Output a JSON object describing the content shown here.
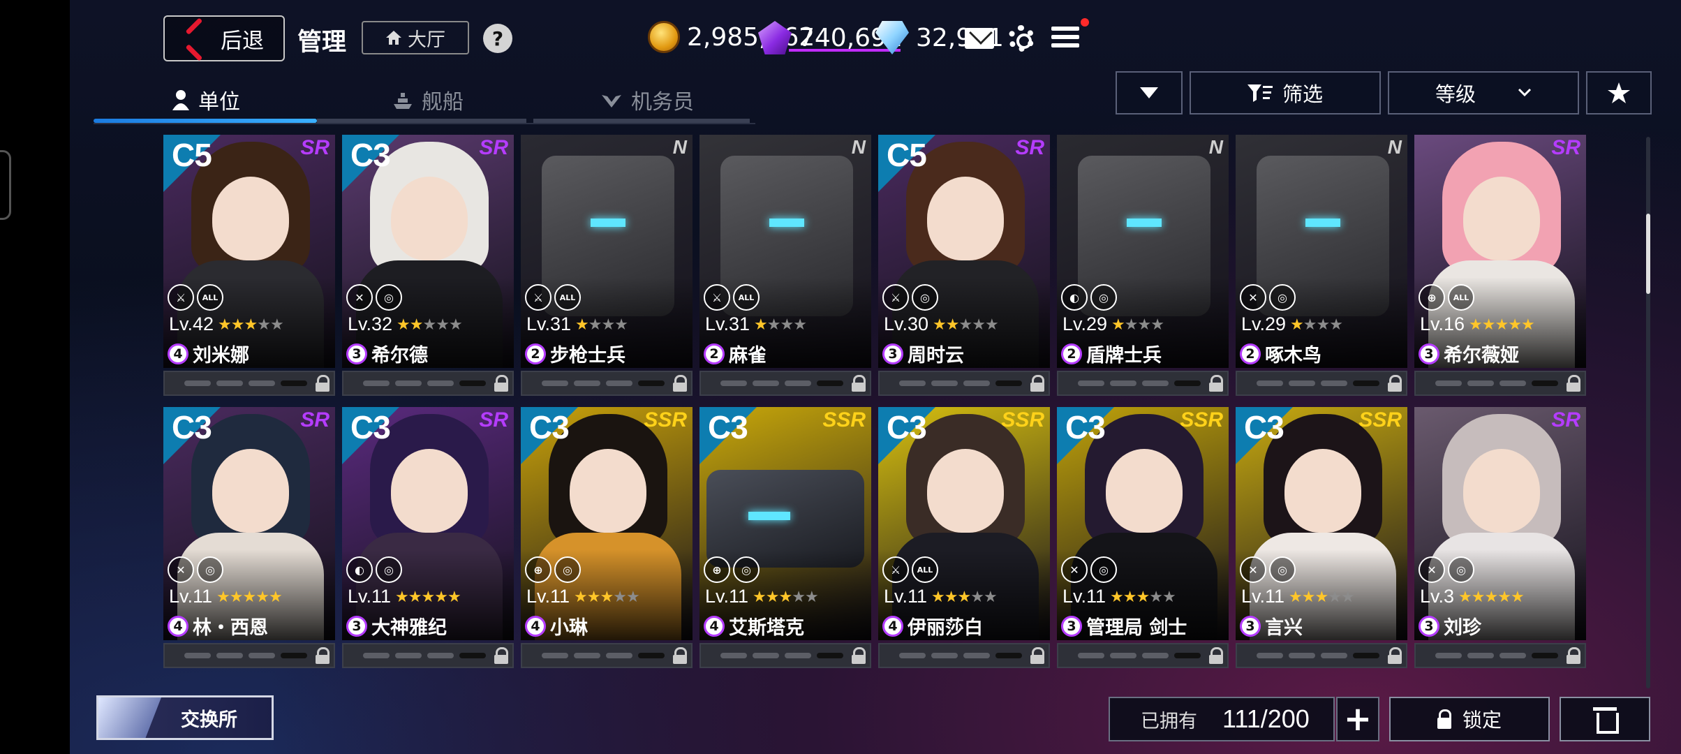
{
  "header": {
    "back_label": "后退",
    "title": "管理",
    "lobby_label": "大厅",
    "help_label": "?"
  },
  "resources": {
    "gold": "2,985,562",
    "gems": "740,692",
    "diamonds": "32,911"
  },
  "tabs": [
    {
      "label": "单位",
      "icon": "person-icon",
      "active": true
    },
    {
      "label": "舰船",
      "icon": "ship-icon",
      "active": false
    },
    {
      "label": "机务员",
      "icon": "wings-icon",
      "active": false
    }
  ],
  "filters": {
    "dropdown_icon": "triangle-down-icon",
    "filter_label": "筛选",
    "sort_label": "等级",
    "favorite_icon": "star-icon"
  },
  "units": [
    {
      "cls": "C5",
      "rarity": "SR",
      "roles": [
        "RF",
        "ALL"
      ],
      "level": "Lv.42",
      "stars": 3,
      "cost": "4",
      "name": "刘米娜",
      "hair": "#3b2416",
      "outfit": "#2b2b30",
      "bg": "#4a2a5e"
    },
    {
      "cls": "C3",
      "rarity": "SR",
      "roles": [
        "SW",
        "SH"
      ],
      "level": "Lv.32",
      "stars": 2,
      "cost": "3",
      "name": "希尔德",
      "hair": "#e8e6e2",
      "outfit": "#1d1d22",
      "bg": "#5a3a6e"
    },
    {
      "cls": "",
      "rarity": "N",
      "roles": [
        "RF",
        "ALL"
      ],
      "level": "Lv.31",
      "stars": 1,
      "max_stars": 4,
      "cost": "2",
      "name": "步枪士兵",
      "mech": true,
      "bg": "#2a2a32"
    },
    {
      "cls": "",
      "rarity": "N",
      "roles": [
        "RF",
        "ALL"
      ],
      "level": "Lv.31",
      "stars": 1,
      "max_stars": 4,
      "cost": "2",
      "name": "麻雀",
      "mech": true,
      "bg": "#333338"
    },
    {
      "cls": "C5",
      "rarity": "SR",
      "roles": [
        "RF",
        "SH"
      ],
      "level": "Lv.30",
      "stars": 2,
      "cost": "3",
      "name": "周时云",
      "hair": "#4a2a1c",
      "outfit": "#222226",
      "bg": "#4a2a5e"
    },
    {
      "cls": "",
      "rarity": "N",
      "roles": [
        "DF",
        "SH"
      ],
      "level": "Lv.29",
      "stars": 1,
      "max_stars": 4,
      "cost": "2",
      "name": "盾牌士兵",
      "mech": true,
      "bg": "#2a2a30"
    },
    {
      "cls": "",
      "rarity": "N",
      "roles": [
        "SW",
        "SH"
      ],
      "level": "Lv.29",
      "stars": 1,
      "max_stars": 4,
      "cost": "2",
      "name": "啄木鸟",
      "mech": true,
      "bg": "#303036"
    },
    {
      "cls": "",
      "rarity": "SR",
      "roles": [
        "TG",
        "ALL"
      ],
      "level": "Lv.16",
      "stars": 5,
      "cost": "3",
      "name": "希尔薇娅",
      "hair": "#f2a2b2",
      "outfit": "#eae6e2",
      "bg": "#6a4a7e"
    },
    {
      "cls": "C3",
      "rarity": "SR",
      "roles": [
        "SW",
        "SH"
      ],
      "level": "Lv.11",
      "stars": 5,
      "cost": "4",
      "name": "林・西恩",
      "hair": "#1f2a3e",
      "outfit": "#e4dcd4",
      "bg": "#4a2a5e"
    },
    {
      "cls": "C3",
      "rarity": "SR",
      "roles": [
        "DF",
        "SH"
      ],
      "level": "Lv.11",
      "stars": 5,
      "cost": "3",
      "name": "大神雅纪",
      "hair": "#2a1a4a",
      "outfit": "#3a2a44",
      "bg": "#5a2a7e"
    },
    {
      "cls": "C3",
      "rarity": "SSR",
      "roles": [
        "TG",
        "SH"
      ],
      "level": "Lv.11",
      "stars": 3,
      "cost": "4",
      "name": "小琳",
      "hair": "#1a1410",
      "outfit": "#d6922a",
      "bg": "#c9a20a"
    },
    {
      "cls": "C3",
      "rarity": "SSR",
      "roles": [
        "TG",
        "SH"
      ],
      "level": "Lv.11",
      "stars": 3,
      "cost": "4",
      "name": "艾斯塔克",
      "mech": true,
      "tank": true,
      "bg": "#c9a80a"
    },
    {
      "cls": "C3",
      "rarity": "SSR",
      "roles": [
        "RF",
        "ALL"
      ],
      "level": "Lv.11",
      "stars": 3,
      "cost": "4",
      "name": "伊丽莎白",
      "hair": "#3a2c26",
      "outfit": "#1c1c24",
      "bg": "#d8c010"
    },
    {
      "cls": "C3",
      "rarity": "SSR",
      "roles": [
        "SW",
        "SH"
      ],
      "level": "Lv.11",
      "stars": 3,
      "cost": "3",
      "name": "管理局 剑士",
      "hair": "#241a30",
      "outfit": "#141418",
      "bg": "#c0a20a"
    },
    {
      "cls": "C3",
      "rarity": "SSR",
      "roles": [
        "SW",
        "SH"
      ],
      "level": "Lv.11",
      "stars": 3,
      "cost": "3",
      "name": "言兴",
      "hair": "#1c1418",
      "outfit": "#eee8e4",
      "bg": "#c8aa10"
    },
    {
      "cls": "",
      "rarity": "SR",
      "roles": [
        "SW",
        "SH"
      ],
      "level": "Lv.3",
      "stars": 5,
      "cost": "3",
      "name": "刘珍",
      "hair": "#c6bcbc",
      "outfit": "#e8e4e4",
      "bg": "#6a5a6e"
    }
  ],
  "footer": {
    "exchange_label": "交换所",
    "owned_label": "已拥有",
    "owned_value": "111/200",
    "plus_label": "+",
    "lock_label": "锁定"
  },
  "colors": {
    "sr": "#b53cff",
    "ssr": "#ffd21a",
    "star": "#ffc629",
    "tab_accent": "#1b7be0"
  }
}
